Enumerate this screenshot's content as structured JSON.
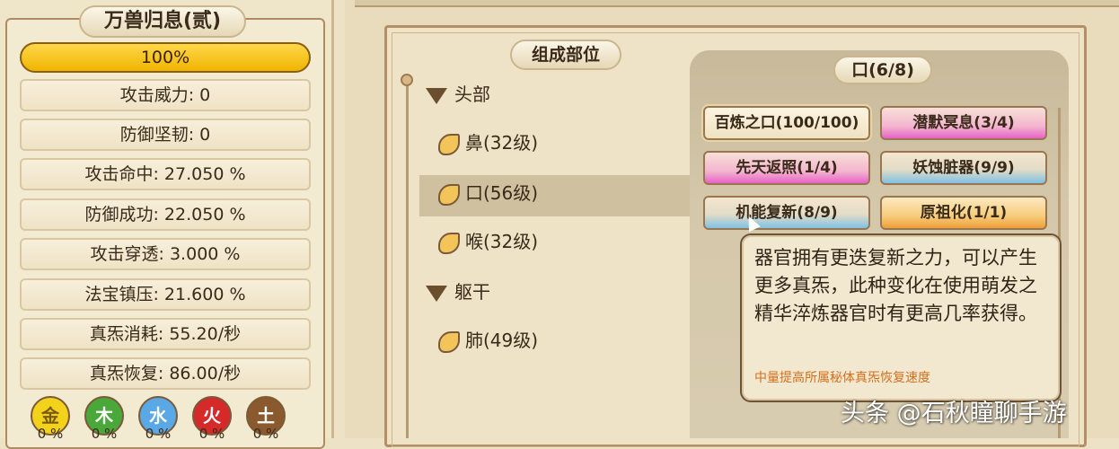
{
  "left_panel": {
    "title": "万兽归息(贰)",
    "progress": {
      "label": "100%",
      "value": 1.0,
      "color": "#f5c21a"
    },
    "stats": [
      "攻击威力: 0",
      "防御坚韧: 0",
      "攻击命中: 27.050 %",
      "防御成功: 22.050 %",
      "攻击穿透: 3.000 %",
      "法宝镇压: 21.600 %",
      "真炁消耗: 55.20/秒",
      "真炁恢复: 86.00/秒"
    ],
    "elements": [
      {
        "label": "金",
        "percent": "0 %",
        "color": "#f2d21a",
        "text_color": "#7a5a10"
      },
      {
        "label": "木",
        "percent": "0 %",
        "color": "#4aa83a",
        "text_color": "#ffffff"
      },
      {
        "label": "水",
        "percent": "0 %",
        "color": "#5aa8e6",
        "text_color": "#ffffff"
      },
      {
        "label": "火",
        "percent": "0 %",
        "color": "#d62a2a",
        "text_color": "#ffffff"
      },
      {
        "label": "土",
        "percent": "0 %",
        "color": "#8a5a2e",
        "text_color": "#ffffff"
      }
    ]
  },
  "parts_panel": {
    "title": "组成部位",
    "categories": [
      {
        "label": "头部",
        "parts": [
          "鼻(32级)",
          "口(56级)",
          "喉(32级)"
        ]
      },
      {
        "label": "躯干",
        "parts": [
          "肺(49级)"
        ]
      }
    ],
    "selected_part": "口(56级)"
  },
  "organ_panel": {
    "title": "口(6/8)",
    "buttons": [
      {
        "label": "百炼之口(100/100)",
        "quality": "white"
      },
      {
        "label": "潜默冥息(3/4)",
        "quality": "pink"
      },
      {
        "label": "先天返照(1/4)",
        "quality": "pink"
      },
      {
        "label": "妖蚀脏器(9/9)",
        "quality": "blue"
      },
      {
        "label": "机能复新(8/9)",
        "quality": "blue"
      },
      {
        "label": "原祖化(1/1)",
        "quality": "orange"
      }
    ]
  },
  "tooltip": {
    "text": "器官拥有更迭复新之力，可以产生更多真炁，此种变化在使用萌发之精华淬炼器官时有更高几率获得。",
    "note": "中量提高所属秘体真炁恢复速度"
  },
  "watermark": "头条 @石秋瞳聊手游",
  "colors": {
    "accent_gold": "#f5c21a",
    "tooltip_note": "#d2701e",
    "frame_brown": "#b48e66"
  }
}
